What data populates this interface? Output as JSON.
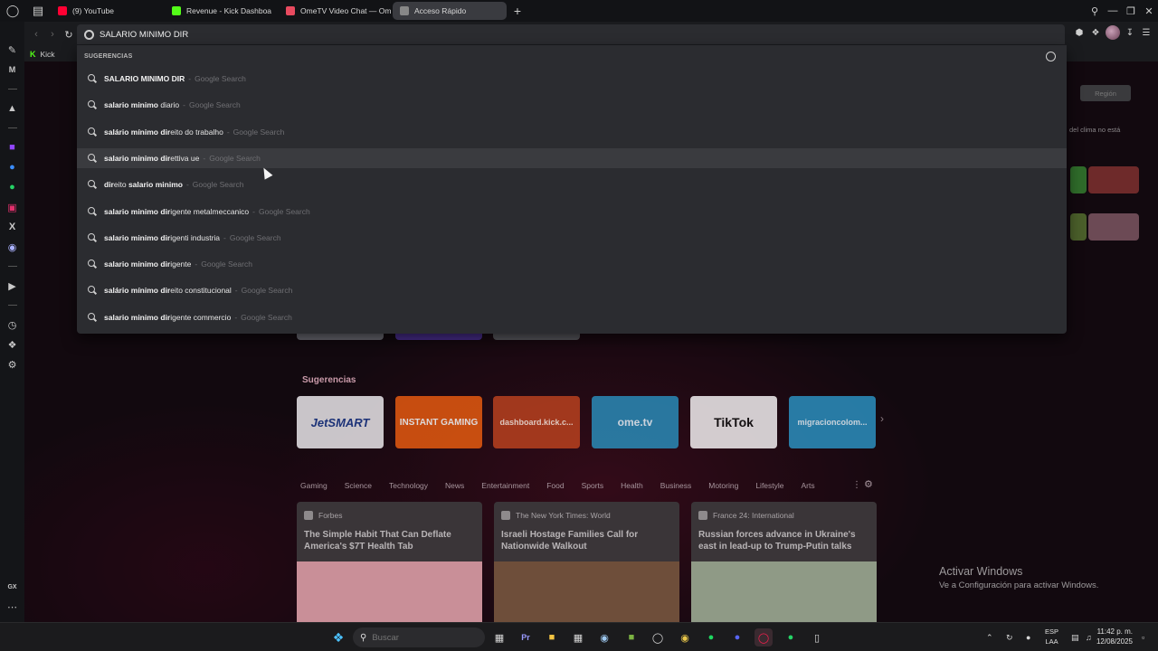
{
  "tabs": [
    {
      "label": "(9) YouTube",
      "color": "#ff0033",
      "active": false
    },
    {
      "label": "Revenue - Kick Dashboa",
      "color": "#53fc18",
      "active": false
    },
    {
      "label": "OmeTV Video Chat — Om",
      "color": "#e84a5f",
      "active": false
    },
    {
      "label": "Acceso Rápido",
      "color": "#888888",
      "active": true
    }
  ],
  "address": {
    "value": "SALARIO MINIMO DIR"
  },
  "bookmarks": [
    {
      "label": "Kick"
    }
  ],
  "dropdown": {
    "header": "SUGERENCIAS",
    "suggestions": [
      {
        "bold1": "SALARIO MINIMO DIR",
        "normal": "",
        "bold2": "",
        "normal2": "",
        "engine": "Google Search"
      },
      {
        "bold1": "salario minimo",
        "normal": " diario",
        "bold2": "",
        "normal2": "",
        "engine": "Google Search"
      },
      {
        "bold1": "salário mínimo dir",
        "normal": "eito do trabalho",
        "bold2": "",
        "normal2": "",
        "engine": "Google Search"
      },
      {
        "bold1": "salario minimo dir",
        "normal": "ettiva ue",
        "bold2": "",
        "normal2": "",
        "engine": "Google Search"
      },
      {
        "bold1": "dir",
        "normal": "eito ",
        "bold2": "salario minimo",
        "normal2": "",
        "engine": "Google Search"
      },
      {
        "bold1": "salario minimo dir",
        "normal": "igente metalmeccanico",
        "bold2": "",
        "normal2": "",
        "engine": "Google Search"
      },
      {
        "bold1": "salario minimo dir",
        "normal": "igenti industria",
        "bold2": "",
        "normal2": "",
        "engine": "Google Search"
      },
      {
        "bold1": "salario minimo dir",
        "normal": "igente",
        "bold2": "",
        "normal2": "",
        "engine": "Google Search"
      },
      {
        "bold1": "salário mínimo dir",
        "normal": "eito constitucional",
        "bold2": "",
        "normal2": "",
        "engine": "Google Search"
      },
      {
        "bold1": "salario minimo dir",
        "normal": "igente commercio",
        "bold2": "",
        "normal2": "",
        "engine": "Google Search"
      }
    ],
    "hovered_index": 3
  },
  "page": {
    "suggestions_title": "Sugerencias",
    "speed_dials": [
      {
        "label": "JetSMART",
        "bg": "#e9e6ea",
        "fg": "#1d3a8a"
      },
      {
        "label": "INSTANT GAMING",
        "bg": "#e55a10",
        "fg": "#ffffff"
      },
      {
        "label": "dashboard.kick.c...",
        "bg": "#b8411f",
        "fg": "#ffe9dd"
      },
      {
        "label": "ome.tv",
        "bg": "#2a8bb8",
        "fg": "#e8f6ff"
      },
      {
        "label": "TikTok",
        "bg": "#f2eef0",
        "fg": "#111111"
      },
      {
        "label": "migracioncolom...",
        "bg": "#2b8fbf",
        "fg": "#e8f6ff"
      }
    ],
    "categories": [
      "Gaming",
      "Science",
      "Technology",
      "News",
      "Entertainment",
      "Food",
      "Sports",
      "Health",
      "Business",
      "Motoring",
      "Lifestyle",
      "Arts"
    ],
    "news": [
      {
        "source": "Forbes",
        "title": "The Simple Habit That Can Deflate America's $7T Health Tab",
        "img": "#c98f98"
      },
      {
        "source": "The New York Times: World",
        "title": "Israeli Hostage Families Call for Nationwide Walkout",
        "img": "#6e4e3a"
      },
      {
        "source": "France 24: International",
        "title": "Russian forces advance in Ukraine's east in lead-up to Trump-Putin talks",
        "img": "#8f9a86"
      }
    ],
    "weather_note": "del clima no está",
    "right_button": "Región"
  },
  "watermark": {
    "line1": "Activar Windows",
    "line2": "Ve a Configuración para activar Windows."
  },
  "taskbar": {
    "search_placeholder": "Buscar",
    "lang_top": "ESP",
    "lang_bottom": "LAA",
    "time": "11:42 p. m.",
    "date": "12/08/2025"
  }
}
